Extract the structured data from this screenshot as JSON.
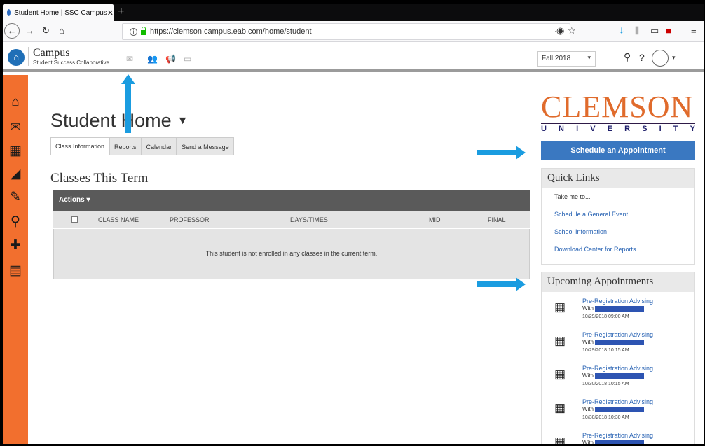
{
  "browser": {
    "tab_title": "Student Home | SSC Campus",
    "tab_close": "✕",
    "new_tab": "+",
    "url": "https://clemson.campus.eab.com/home/student",
    "page_actions": "···"
  },
  "app": {
    "brand_title": "Campus",
    "brand_subtitle": "Student Success Collaborative",
    "term_select": "Fall 2018",
    "help": "?"
  },
  "main": {
    "page_title": "Student Home",
    "tabs": [
      "Class Information",
      "Reports",
      "Calendar",
      "Send a Message"
    ],
    "section_title": "Classes This Term",
    "actions_label": "Actions",
    "columns": [
      "CLASS NAME",
      "PROFESSOR",
      "DAYS/TIMES",
      "MID",
      "FINAL"
    ],
    "empty_message": "This student is not enrolled in any classes in the current term."
  },
  "right": {
    "school_wordmark": "CLEMSON",
    "school_sub": [
      "U",
      "N",
      "I",
      "V",
      "E",
      "R",
      "S",
      "I",
      "T",
      "Y"
    ],
    "schedule_button": "Schedule an Appointment",
    "quick_links": {
      "title": "Quick Links",
      "prompt": "Take me to...",
      "links": [
        "Schedule a General Event",
        "School Information",
        "Download Center for Reports"
      ]
    },
    "upcoming": {
      "title": "Upcoming Appointments",
      "with_label": "With",
      "items": [
        {
          "name": "Pre-Registration Advising",
          "date": "10/29/2018 09:00 AM"
        },
        {
          "name": "Pre-Registration Advising",
          "date": "10/29/2018 10:15 AM"
        },
        {
          "name": "Pre-Registration Advising",
          "date": "10/30/2018 10:15 AM"
        },
        {
          "name": "Pre-Registration Advising",
          "date": "10/30/2018 10:30 AM"
        },
        {
          "name": "Pre-Registration Advising",
          "date": ""
        }
      ]
    }
  },
  "colors": {
    "rail": "#f26f2e",
    "accent_blue": "#3a78c1",
    "annotation_arrow": "#1a9ce0",
    "clemson_orange": "#e06b2c"
  },
  "icons": {
    "rail": [
      "home-icon",
      "mail-icon",
      "calendar-icon",
      "chart-icon",
      "pin-icon",
      "search-icon",
      "add-user-icon",
      "notes-icon"
    ]
  }
}
